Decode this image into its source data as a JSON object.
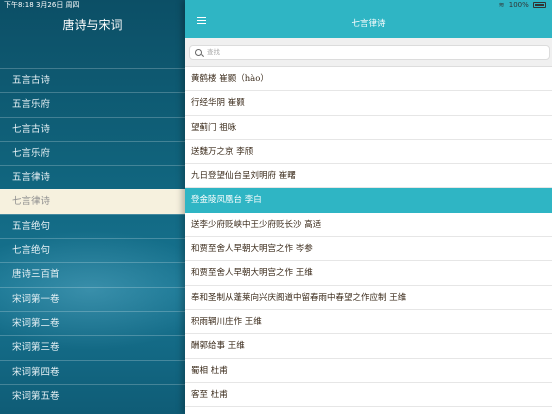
{
  "status": {
    "time": "下午8:18",
    "date": "3月26日 周四",
    "battery": "100%"
  },
  "sidebar": {
    "title": "唐诗与宋词",
    "items": [
      {
        "label": "五言古诗"
      },
      {
        "label": "五言乐府"
      },
      {
        "label": "七言古诗"
      },
      {
        "label": "七言乐府"
      },
      {
        "label": "五言律诗"
      },
      {
        "label": "七言律诗",
        "active": true
      },
      {
        "label": "五言绝句"
      },
      {
        "label": "七言绝句"
      },
      {
        "label": "唐诗三百首"
      },
      {
        "label": "宋词第一卷"
      },
      {
        "label": "宋词第二卷"
      },
      {
        "label": "宋词第三卷"
      },
      {
        "label": "宋词第四卷"
      },
      {
        "label": "宋词第五卷"
      }
    ]
  },
  "header": {
    "title": "七言律诗",
    "menu_icon": "hamburger-icon"
  },
  "search": {
    "placeholder": "查找",
    "value": ""
  },
  "poems": [
    {
      "label": "黄鹤楼 崔颢（hào）"
    },
    {
      "label": "行经华阴 崔颢"
    },
    {
      "label": "望蓟门 祖咏"
    },
    {
      "label": "送魏万之京 李颀"
    },
    {
      "label": "九日登望仙台呈刘明府 崔曙"
    },
    {
      "label": "登金陵凤凰台 李白",
      "active": true
    },
    {
      "label": "送李少府贬峡中王少府贬长沙 高适"
    },
    {
      "label": "和贾至舍人早朝大明宫之作 岑参"
    },
    {
      "label": "和贾至舍人早朝大明宫之作 王维"
    },
    {
      "label": "奉和圣制从蓬莱向兴庆阁道中留春雨中春望之作应制 王维"
    },
    {
      "label": "积雨辋川庄作 王维"
    },
    {
      "label": "酬郭给事 王维"
    },
    {
      "label": "蜀相 杜甫"
    },
    {
      "label": "客至 杜甫"
    }
  ],
  "colors": {
    "accent": "#2fb5c4",
    "sidebar_bg": "#10637c",
    "active_side": "#f6f1de"
  }
}
